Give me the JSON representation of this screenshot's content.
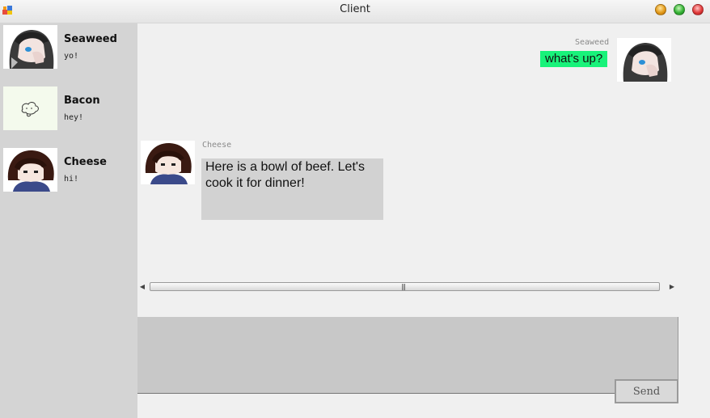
{
  "window": {
    "title": "Client"
  },
  "contacts": [
    {
      "name": "Seaweed",
      "last_message": "yo!",
      "avatar": "dark-hair-girl-avatar"
    },
    {
      "name": "Bacon",
      "last_message": "hey!",
      "avatar": "bacon-doodle-avatar"
    },
    {
      "name": "Cheese",
      "last_message": "hi!",
      "avatar": "brown-hair-boy-avatar"
    }
  ],
  "messages": [
    {
      "sender": "Seaweed",
      "text": "what's up?",
      "side": "right",
      "color": "#18f27a"
    },
    {
      "sender": "Cheese",
      "text": "Here is a bowl of beef. Let's cook it for dinner!",
      "side": "left",
      "color": "#d2d2d2"
    }
  ],
  "composer": {
    "value": "",
    "send_label": "Send"
  }
}
